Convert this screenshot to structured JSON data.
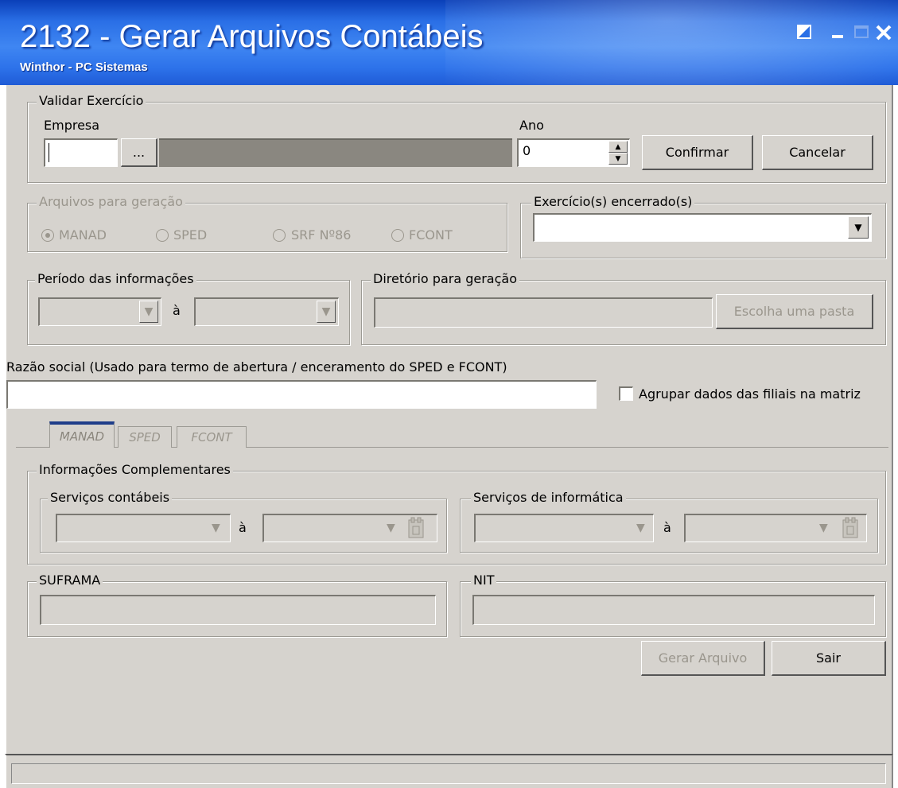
{
  "window": {
    "title": "2132 - Gerar Arquivos Contábeis",
    "subtitle": "Winthor - PC Sistemas"
  },
  "validar": {
    "legend": "Validar Exercício",
    "empresa_label": "Empresa",
    "empresa_value": "",
    "lookup_label": "...",
    "ano_label": "Ano",
    "ano_value": "0",
    "confirmar_label": "Confirmar",
    "cancelar_label": "Cancelar"
  },
  "arquivos": {
    "legend": "Arquivos para geração",
    "options": [
      "MANAD",
      "SPED",
      "SRF Nº86",
      "FCONT"
    ],
    "selected": "MANAD"
  },
  "exercicios": {
    "legend": "Exercício(s) encerrado(s)",
    "value": ""
  },
  "periodo": {
    "legend": "Período das informações",
    "separator": "à"
  },
  "diretorio": {
    "legend": "Diretório para geração",
    "value": "",
    "button_label": "Escolha uma pasta"
  },
  "razao": {
    "label": "Razão social (Usado para termo de abertura / enceramento do SPED e FCONT)",
    "value": "",
    "agrupar_label": "Agrupar dados das filiais na matriz",
    "agrupar_checked": false
  },
  "tabs": [
    "MANAD",
    "SPED",
    "FCONT"
  ],
  "complementares": {
    "legend": "Informações Complementares",
    "contabeis_legend": "Serviços contábeis",
    "informatica_legend": "Serviços de informática",
    "separator": "à"
  },
  "suframa": {
    "legend": "SUFRAMA",
    "value": ""
  },
  "nit": {
    "legend": "NIT",
    "value": ""
  },
  "footer": {
    "gerar_label": "Gerar Arquivo",
    "sair_label": "Sair"
  }
}
